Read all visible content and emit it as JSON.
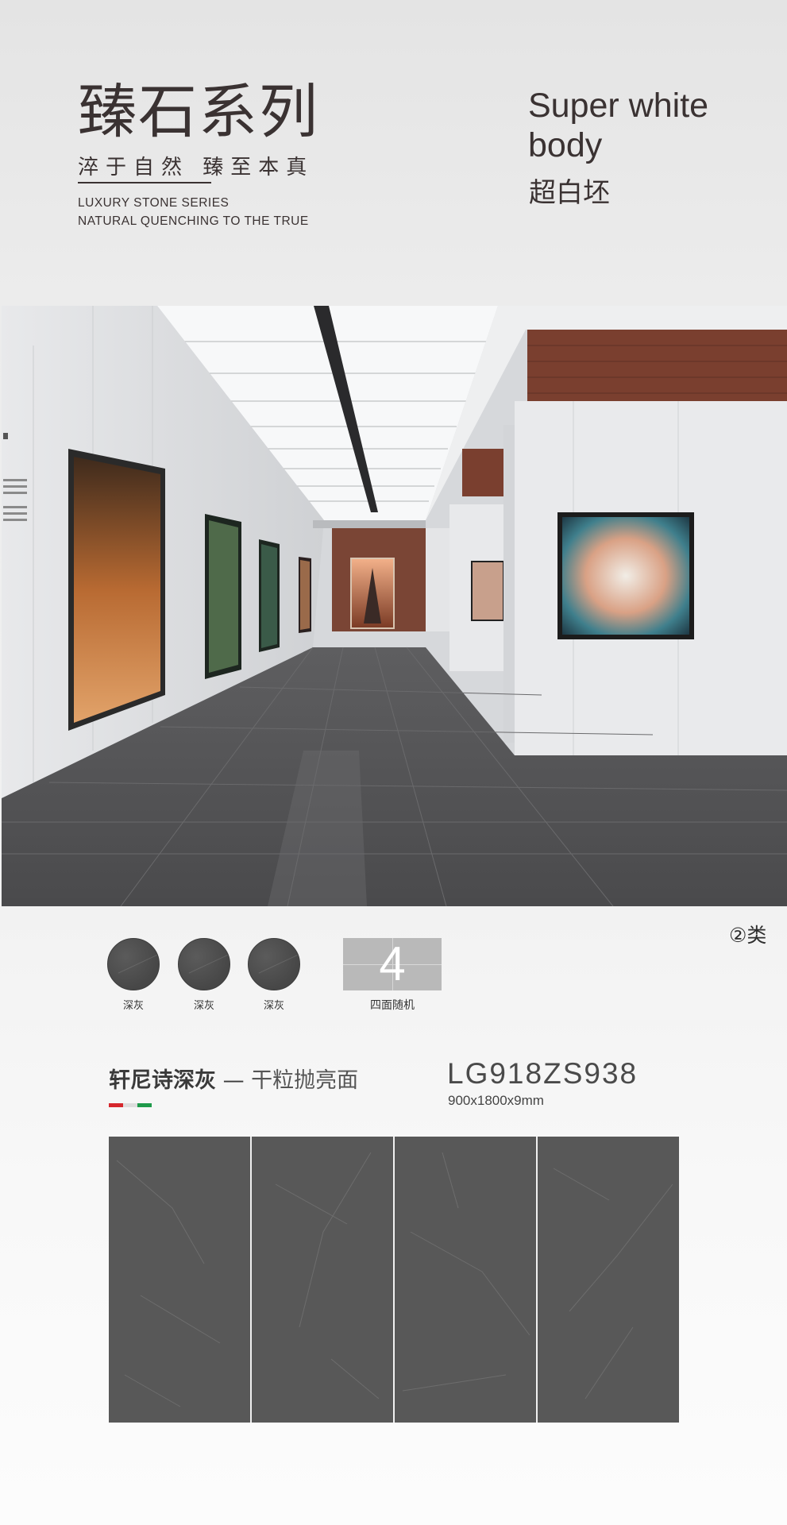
{
  "header": {
    "title_cn": "臻石系列",
    "slogan_cn": "淬于自然  臻至本真",
    "series_en_line1": "LUXURY STONE SERIES",
    "series_en_line2": "NATURAL QUENCHING TO THE TRUE",
    "body_type_en_line1": "Super white",
    "body_type_en_line2": "body",
    "body_type_cn": "超白坯"
  },
  "category_badge": "②类",
  "swatches": [
    {
      "label": "深灰",
      "color": "#505050"
    },
    {
      "label": "深灰",
      "color": "#505050"
    },
    {
      "label": "深灰",
      "color": "#505050"
    }
  ],
  "layout": {
    "count": "4",
    "label": "四面随机"
  },
  "product": {
    "name": "轩尼诗深灰",
    "dash": " — ",
    "finish": "干粒抛亮面",
    "code": "LG918ZS938",
    "size": "900x1800x9mm",
    "flag_colors": [
      "#d6272d",
      "#dddddd",
      "#1f9a4a"
    ]
  },
  "slab_count": 4,
  "colors": {
    "slab": "#585858",
    "floor": "#4e4e50",
    "wall": "#e3e4e6"
  }
}
